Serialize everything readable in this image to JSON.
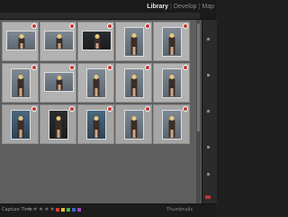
{
  "modules": {
    "library": "Library",
    "develop": "Develop",
    "map": "Map"
  },
  "toolbar": {
    "sort_label": "Capture Time",
    "thumbnails_label": "Thumbnails"
  },
  "rating": {
    "stars": "★★★★★"
  },
  "label_colors": [
    "#d23a30",
    "#e0c22a",
    "#4cb84a",
    "#3a66d0",
    "#9a48c0"
  ],
  "grid": {
    "cells": [
      {
        "photo": "grey",
        "orientation": "landscape",
        "badge": true
      },
      {
        "photo": "grey",
        "orientation": "landscape",
        "badge": true
      },
      {
        "photo": "dark",
        "orientation": "landscape",
        "badge": true
      },
      {
        "photo": "grey",
        "orientation": "portrait",
        "badge": true
      },
      {
        "photo": "grey",
        "orientation": "portrait",
        "badge": true
      },
      {
        "photo": "grey",
        "orientation": "portrait",
        "badge": true
      },
      {
        "photo": "grey",
        "orientation": "landscape",
        "badge": true
      },
      {
        "photo": "grey",
        "orientation": "portrait",
        "badge": true
      },
      {
        "photo": "grey",
        "orientation": "portrait",
        "badge": true
      },
      {
        "photo": "grey",
        "orientation": "portrait",
        "badge": true
      },
      {
        "photo": "blue",
        "orientation": "portrait",
        "badge": true
      },
      {
        "photo": "dark",
        "orientation": "portrait",
        "badge": true
      },
      {
        "photo": "blue",
        "orientation": "portrait",
        "badge": true
      },
      {
        "photo": "grey",
        "orientation": "portrait",
        "badge": true
      },
      {
        "photo": "grey",
        "orientation": "portrait",
        "badge": true
      }
    ]
  }
}
